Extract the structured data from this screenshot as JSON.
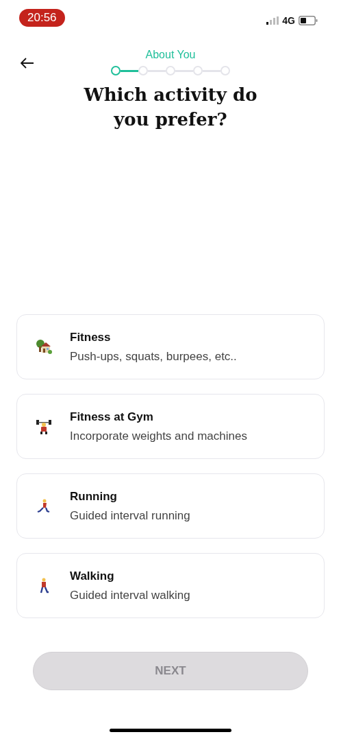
{
  "status_bar": {
    "time": "20:56",
    "network": "4G"
  },
  "header": {
    "section": "About You",
    "steps": [
      {
        "selected": true
      },
      {
        "selected": false
      },
      {
        "selected": false
      },
      {
        "selected": false
      },
      {
        "selected": false
      }
    ]
  },
  "title": "Which activity do you prefer?",
  "options": [
    {
      "kind": "home",
      "title": "Fitness",
      "subtitle": "Push-ups, squats, burpees, etc.."
    },
    {
      "kind": "gym",
      "title": "Fitness at Gym",
      "subtitle": "Incorporate weights and machines"
    },
    {
      "kind": "run",
      "title": "Running",
      "subtitle": "Guided interval running"
    },
    {
      "kind": "walk",
      "title": "Walking",
      "subtitle": "Guided interval walking"
    }
  ],
  "next_button": {
    "label": "NEXT",
    "disabled": true
  }
}
